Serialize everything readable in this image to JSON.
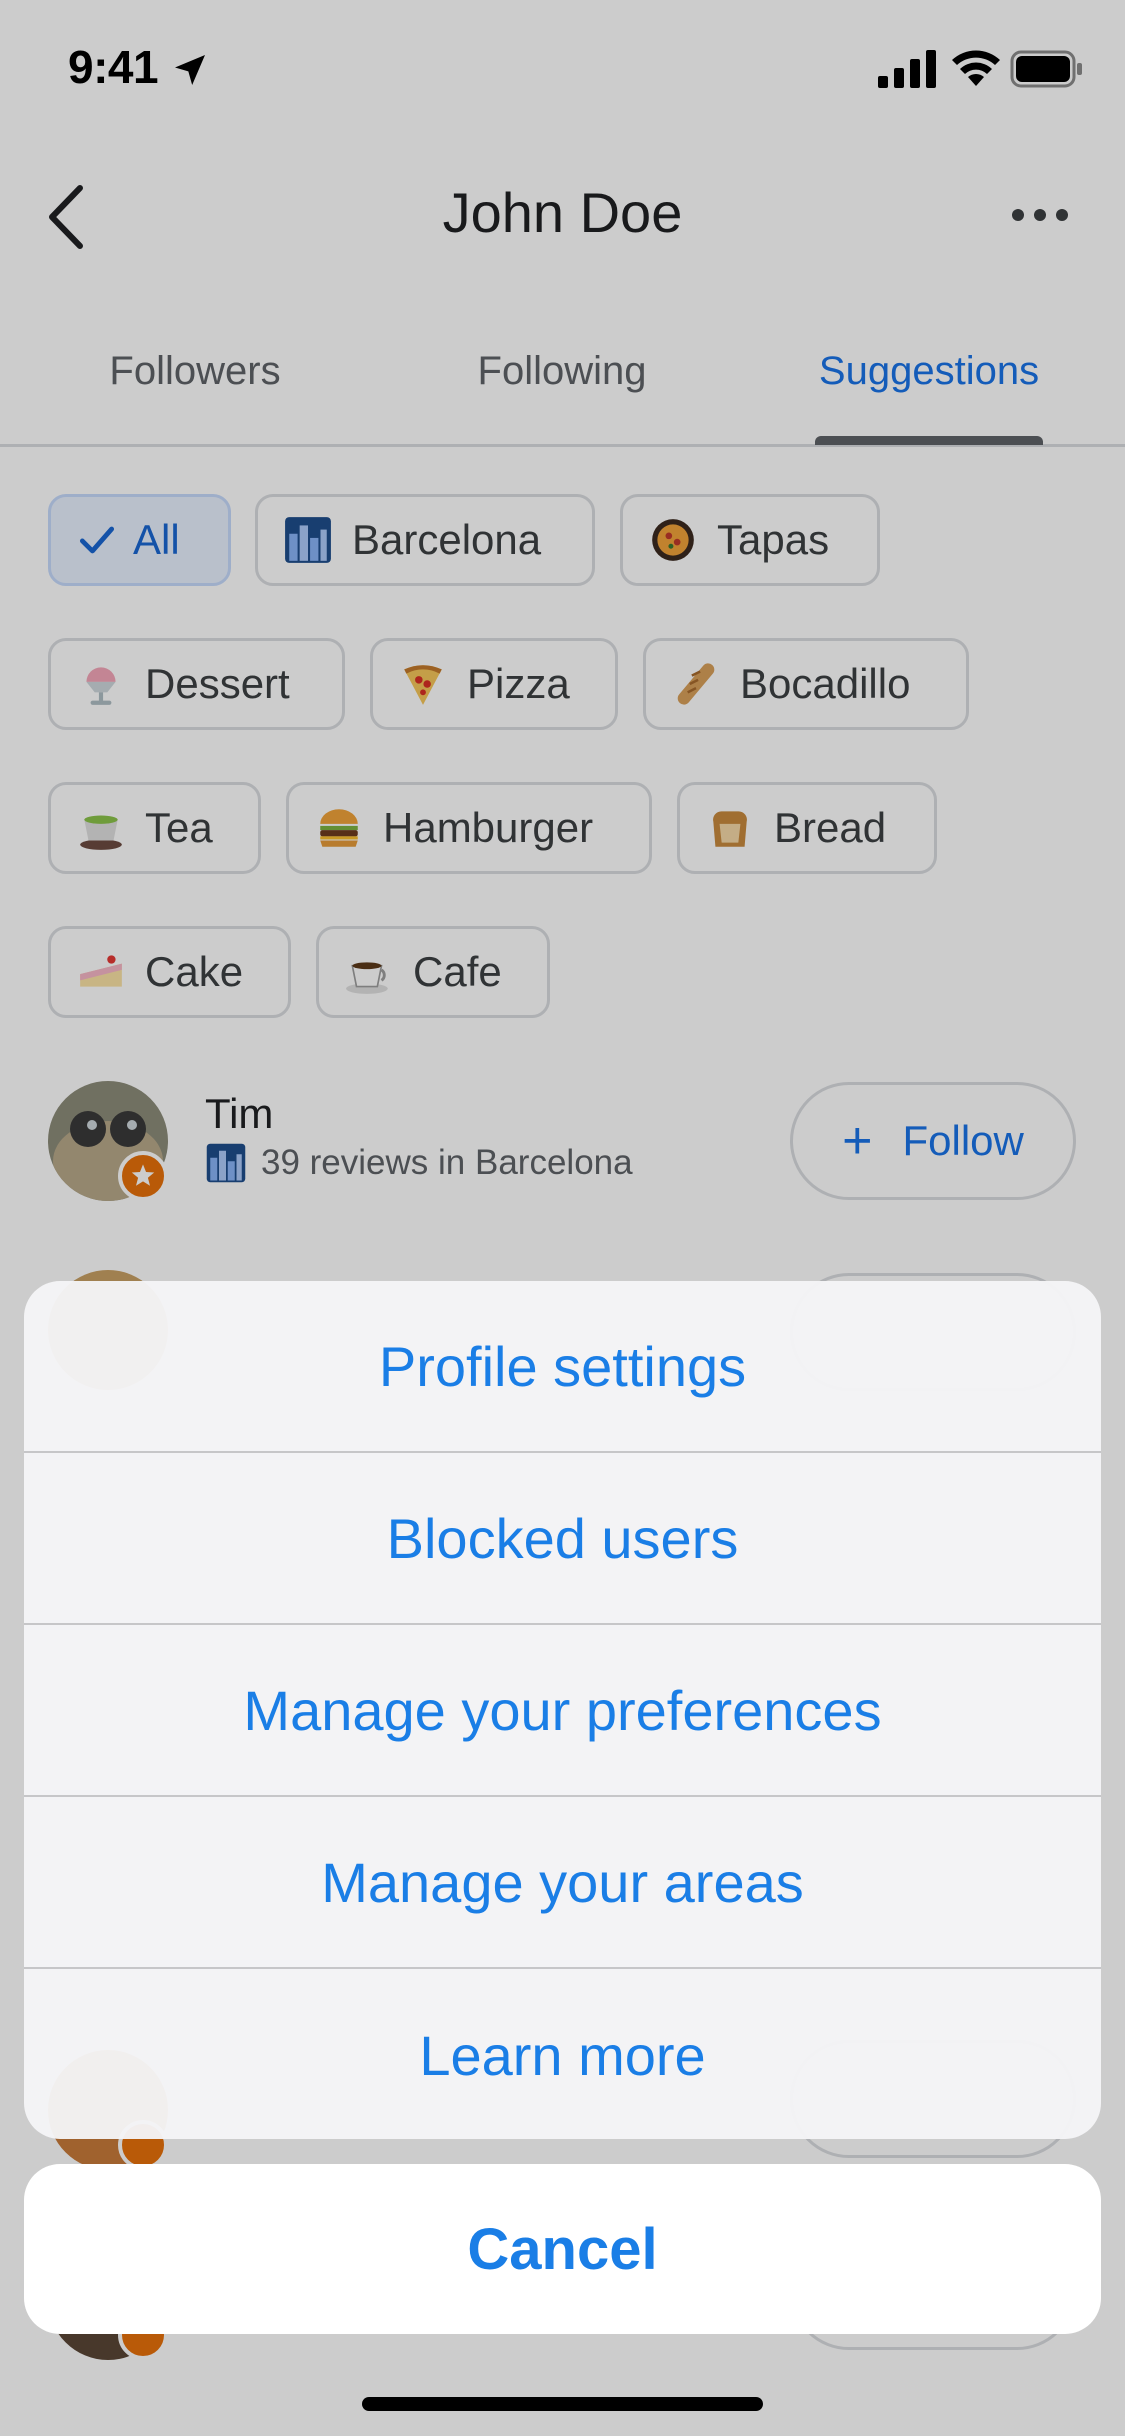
{
  "status_bar": {
    "time": "9:41"
  },
  "header": {
    "title": "John Doe"
  },
  "tabs": [
    {
      "label": "Followers"
    },
    {
      "label": "Following"
    },
    {
      "label": "Suggestions"
    }
  ],
  "chips": [
    {
      "label": "All",
      "icon": "check-icon"
    },
    {
      "label": "Barcelona",
      "icon": "city-icon"
    },
    {
      "label": "Tapas",
      "icon": "paella-icon"
    },
    {
      "label": "Dessert",
      "icon": "shaved-ice-icon"
    },
    {
      "label": "Pizza",
      "icon": "pizza-icon"
    },
    {
      "label": "Bocadillo",
      "icon": "baguette-icon"
    },
    {
      "label": "Tea",
      "icon": "tea-icon"
    },
    {
      "label": "Hamburger",
      "icon": "hamburger-icon"
    },
    {
      "label": "Bread",
      "icon": "bread-icon"
    },
    {
      "label": "Cake",
      "icon": "cake-icon"
    },
    {
      "label": "Cafe",
      "icon": "coffee-icon"
    }
  ],
  "suggestion": {
    "name": "Tim",
    "subtitle": "39 reviews in Barcelona",
    "follow_label": "Follow"
  },
  "action_sheet": {
    "items": [
      "Profile settings",
      "Blocked users",
      "Manage your preferences",
      "Manage your areas",
      "Learn more"
    ],
    "cancel": "Cancel"
  },
  "colors": {
    "accent": "#1a73e8",
    "ios_blue": "#1a7ee6",
    "badge": "#e8710a"
  }
}
